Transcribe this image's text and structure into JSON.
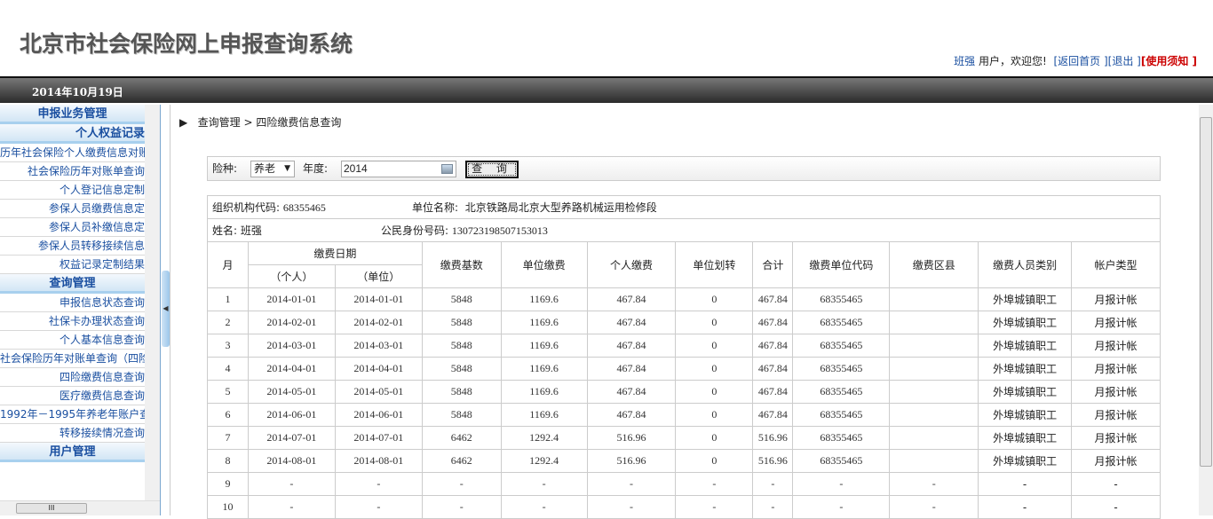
{
  "header": {
    "title": "北京市社会保险网上申报查询系统",
    "user_name": "班强",
    "welcome": "用户，欢迎您!",
    "home": "[返回首页 ]",
    "logout": "[退出 ]",
    "notice_open": "[",
    "notice": "使用须知",
    "notice_close": " ]"
  },
  "date": "2014年10月19日",
  "sidebar": [
    {
      "type": "sec",
      "label": "申报业务管理"
    },
    {
      "type": "sec",
      "label": "个人权益记录",
      "align": "right"
    },
    {
      "type": "it",
      "label": "历年社会保险个人缴费信息对账"
    },
    {
      "type": "it",
      "label": "社会保险历年对账单查询"
    },
    {
      "type": "it",
      "label": "个人登记信息定制"
    },
    {
      "type": "it",
      "label": "参保人员缴费信息定"
    },
    {
      "type": "it",
      "label": "参保人员补缴信息定"
    },
    {
      "type": "it",
      "label": "参保人员转移接续信息"
    },
    {
      "type": "it",
      "label": "权益记录定制结果"
    },
    {
      "type": "sec",
      "label": "查询管理"
    },
    {
      "type": "it",
      "label": "申报信息状态查询"
    },
    {
      "type": "it",
      "label": "社保卡办理状态查询"
    },
    {
      "type": "it",
      "label": "个人基本信息查询"
    },
    {
      "type": "it",
      "label": "社会保险历年对账单查询（四险"
    },
    {
      "type": "it",
      "label": "四险缴费信息查询"
    },
    {
      "type": "it",
      "label": "医疗缴费信息查询"
    },
    {
      "type": "it",
      "label": "1992年－1995年养老年账户查"
    },
    {
      "type": "it",
      "label": "转移接续情况查询"
    },
    {
      "type": "sec",
      "label": "用户管理"
    }
  ],
  "breadcrumb": "查询管理 > 四险缴费信息查询",
  "query": {
    "type_label": "险种:",
    "type_value": "养老",
    "year_label": "年度:",
    "year_value": "2014",
    "button": "查 询"
  },
  "info": {
    "org_label": "组织机构代码:",
    "org_value": "68355465",
    "unit_label": "单位名称:",
    "unit_value": "北京铁路局北京大型养路机械运用检修段",
    "name_label": "姓名:",
    "name_value": "班强",
    "id_label": "公民身份号码:",
    "id_value": "130723198507153013"
  },
  "table": {
    "headers": {
      "month": "月",
      "date": "缴费日期",
      "personal": "（个人）",
      "unit": "（单位）",
      "base": "缴费基数",
      "unit_pay": "单位缴费",
      "personal_pay": "个人缴费",
      "transfer": "单位划转",
      "total": "合计",
      "unit_code": "缴费单位代码",
      "district": "缴费区县",
      "category": "缴费人员类别",
      "account": "帐户类型"
    },
    "rows": [
      [
        "1",
        "2014-01-01",
        "2014-01-01",
        "5848",
        "1169.6",
        "467.84",
        "0",
        "467.84",
        "68355465",
        "",
        "外埠城镇职工",
        "月报计帐"
      ],
      [
        "2",
        "2014-02-01",
        "2014-02-01",
        "5848",
        "1169.6",
        "467.84",
        "0",
        "467.84",
        "68355465",
        "",
        "外埠城镇职工",
        "月报计帐"
      ],
      [
        "3",
        "2014-03-01",
        "2014-03-01",
        "5848",
        "1169.6",
        "467.84",
        "0",
        "467.84",
        "68355465",
        "",
        "外埠城镇职工",
        "月报计帐"
      ],
      [
        "4",
        "2014-04-01",
        "2014-04-01",
        "5848",
        "1169.6",
        "467.84",
        "0",
        "467.84",
        "68355465",
        "",
        "外埠城镇职工",
        "月报计帐"
      ],
      [
        "5",
        "2014-05-01",
        "2014-05-01",
        "5848",
        "1169.6",
        "467.84",
        "0",
        "467.84",
        "68355465",
        "",
        "外埠城镇职工",
        "月报计帐"
      ],
      [
        "6",
        "2014-06-01",
        "2014-06-01",
        "5848",
        "1169.6",
        "467.84",
        "0",
        "467.84",
        "68355465",
        "",
        "外埠城镇职工",
        "月报计帐"
      ],
      [
        "7",
        "2014-07-01",
        "2014-07-01",
        "6462",
        "1292.4",
        "516.96",
        "0",
        "516.96",
        "68355465",
        "",
        "外埠城镇职工",
        "月报计帐"
      ],
      [
        "8",
        "2014-08-01",
        "2014-08-01",
        "6462",
        "1292.4",
        "516.96",
        "0",
        "516.96",
        "68355465",
        "",
        "外埠城镇职工",
        "月报计帐"
      ],
      [
        "9",
        "-",
        "-",
        "-",
        "-",
        "-",
        "-",
        "-",
        "-",
        "-",
        "-",
        "-"
      ],
      [
        "10",
        "-",
        "-",
        "-",
        "-",
        "-",
        "-",
        "-",
        "-",
        "-",
        "-",
        "-"
      ]
    ]
  }
}
